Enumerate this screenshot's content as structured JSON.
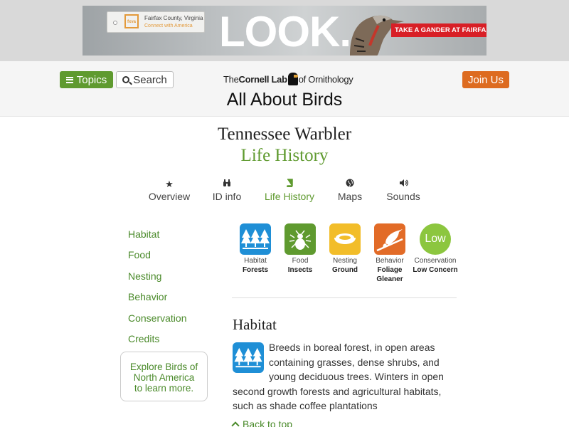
{
  "ad": {
    "tag_line1": "Fairfax County, Virginia",
    "tag_line2": "Connect with America",
    "tag_logo": "fxva",
    "headline": "LOOK.",
    "cta": "TAKE A GANDER AT FAIRFAX!"
  },
  "header": {
    "topics_label": "Topics",
    "search_label": "Search",
    "lab_prefix": "The",
    "lab_name": "Cornell Lab",
    "lab_suffix": "of Ornithology",
    "site_title": "All About Birds",
    "join_label": "Join Us"
  },
  "page": {
    "species": "Tennessee Warbler",
    "section": "Life History"
  },
  "tabs": [
    {
      "label": "Overview",
      "icon": "star-icon"
    },
    {
      "label": "ID info",
      "icon": "binoculars-icon"
    },
    {
      "label": "Life History",
      "icon": "book-icon",
      "active": true
    },
    {
      "label": "Maps",
      "icon": "globe-icon"
    },
    {
      "label": "Sounds",
      "icon": "speaker-icon"
    }
  ],
  "sidebar": {
    "items": [
      "Habitat",
      "Food",
      "Nesting",
      "Behavior",
      "Conservation",
      "Credits"
    ],
    "explore": [
      "Explore Birds of",
      "North America",
      "to learn more."
    ]
  },
  "facts": [
    {
      "label": "Habitat",
      "value": "Forests",
      "icon": "forest-icon",
      "color": "#1f8fd6"
    },
    {
      "label": "Food",
      "value": "Insects",
      "icon": "insect-icon",
      "color": "#5f9a2f"
    },
    {
      "label": "Nesting",
      "value": "Ground",
      "icon": "nest-icon",
      "color": "#f2bd29"
    },
    {
      "label": "Behavior",
      "value": "Foliage Gleaner",
      "icon": "bird-on-branch-icon",
      "color": "#e26b27"
    },
    {
      "label": "Conservation",
      "value": "Low Concern",
      "badge": "Low",
      "color": "#8cc63f"
    }
  ],
  "habitat": {
    "heading": "Habitat",
    "text": "Breeds in boreal forest, in open areas containing grasses, dense shrubs, and young deciduous trees. Winters in open second growth forests and agricultural habitats, such as shade coffee plantations",
    "back_to_top": "Back to top"
  },
  "colors": {
    "accent_green": "#5f9a2f",
    "join_orange": "#dd6b20",
    "link_green": "#4a8a2a"
  }
}
